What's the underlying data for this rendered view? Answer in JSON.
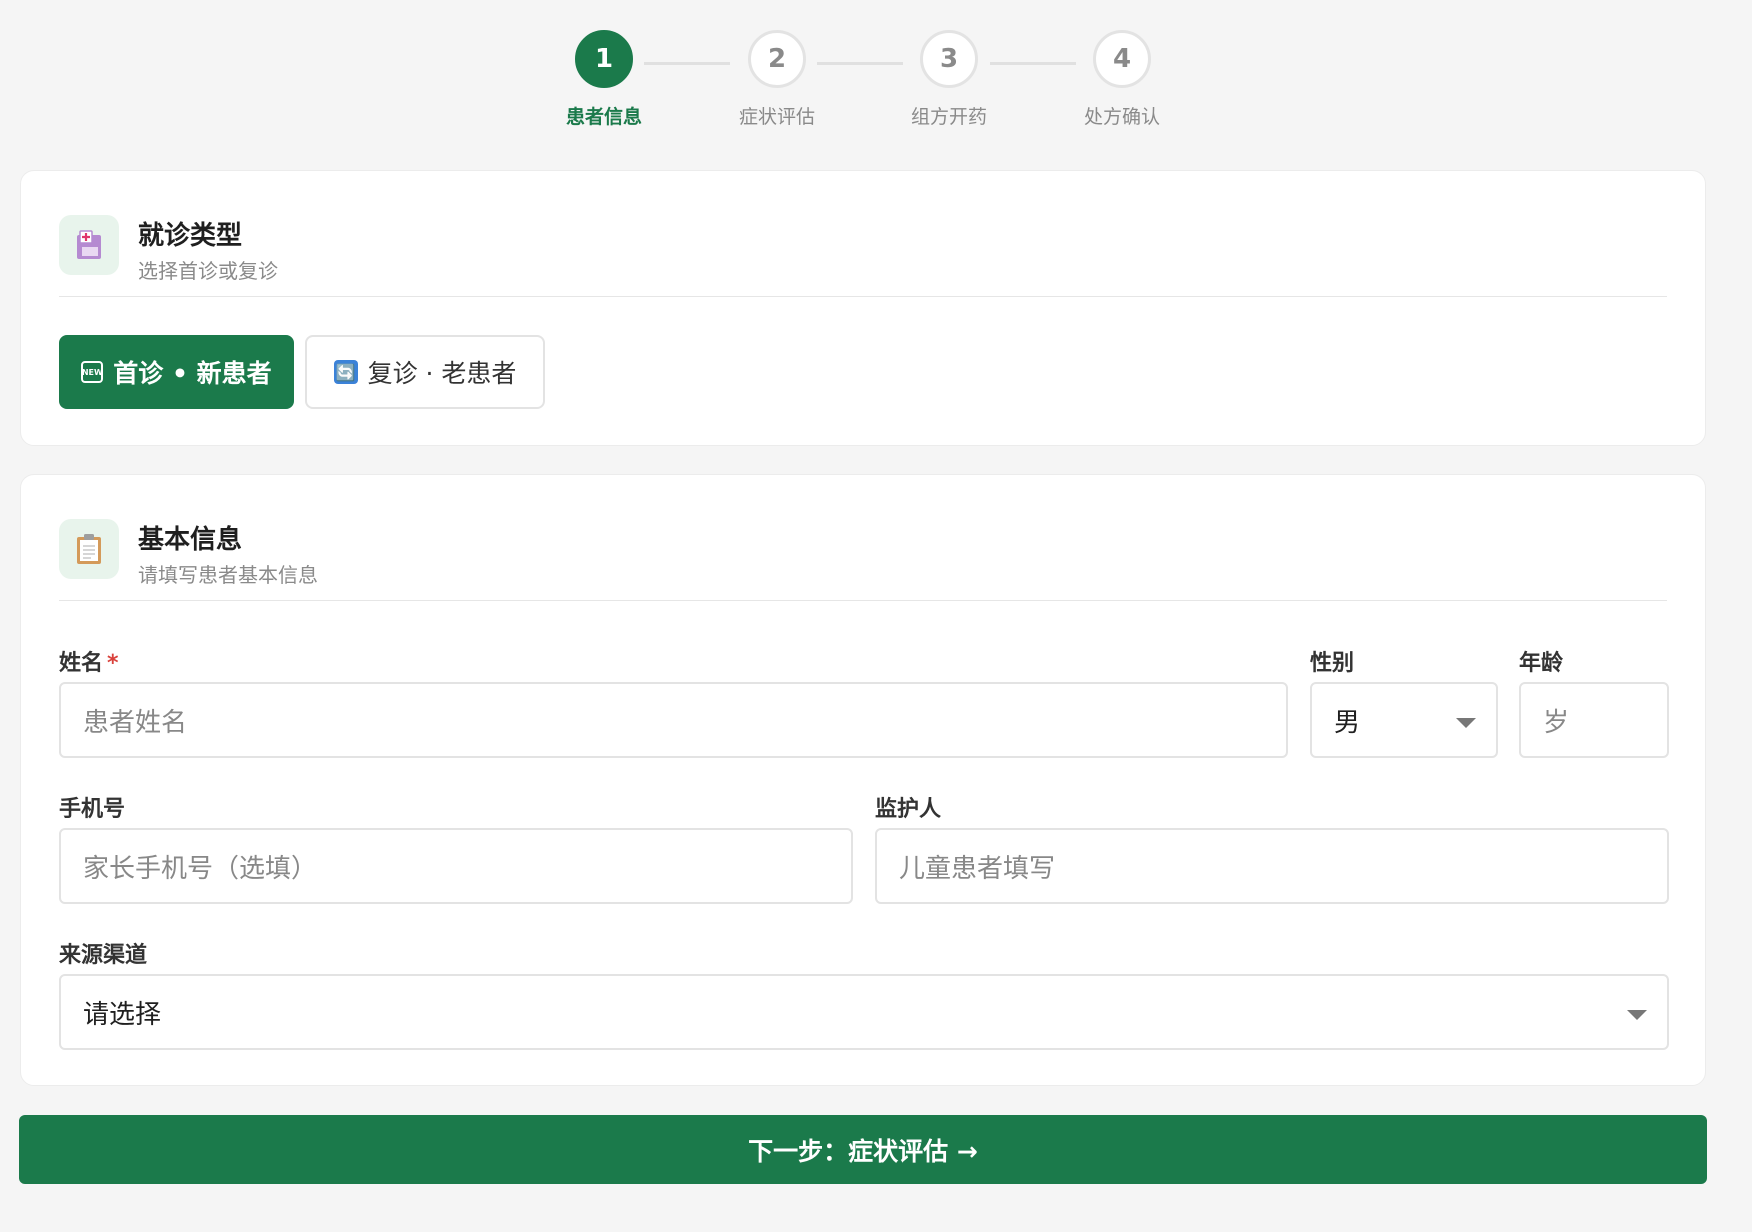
{
  "stepper": {
    "steps": [
      {
        "number": "1",
        "label": "患者信息",
        "active": true
      },
      {
        "number": "2",
        "label": "症状评估",
        "active": false
      },
      {
        "number": "3",
        "label": "组方开药",
        "active": false
      },
      {
        "number": "4",
        "label": "处方确认",
        "active": false
      }
    ]
  },
  "visit_type": {
    "icon": "hospital-icon",
    "title": "就诊类型",
    "subtitle": "选择首诊或复诊",
    "options": [
      {
        "icon": "new-icon",
        "icon_text": "NEW",
        "label": "首诊 • 新患者",
        "selected": true
      },
      {
        "icon": "refresh-icon",
        "icon_text": "🔄",
        "label": "复诊 · 老患者",
        "selected": false
      }
    ]
  },
  "basic_info": {
    "icon": "clipboard-icon",
    "title": "基本信息",
    "subtitle": "请填写患者基本信息",
    "name": {
      "label": "姓名",
      "required_mark": "*",
      "placeholder": "患者姓名"
    },
    "gender": {
      "label": "性别",
      "value": "男"
    },
    "age": {
      "label": "年龄",
      "placeholder": "岁"
    },
    "phone": {
      "label": "手机号",
      "placeholder": "家长手机号（选填）"
    },
    "guardian": {
      "label": "监护人",
      "placeholder": "儿童患者填写"
    },
    "source": {
      "label": "来源渠道",
      "value": "请选择"
    }
  },
  "next_button": {
    "label": "下一步：症状评估 →"
  },
  "colors": {
    "primary": "#1b7a4b",
    "background": "#f5f5f5",
    "required": "#d9413b"
  }
}
